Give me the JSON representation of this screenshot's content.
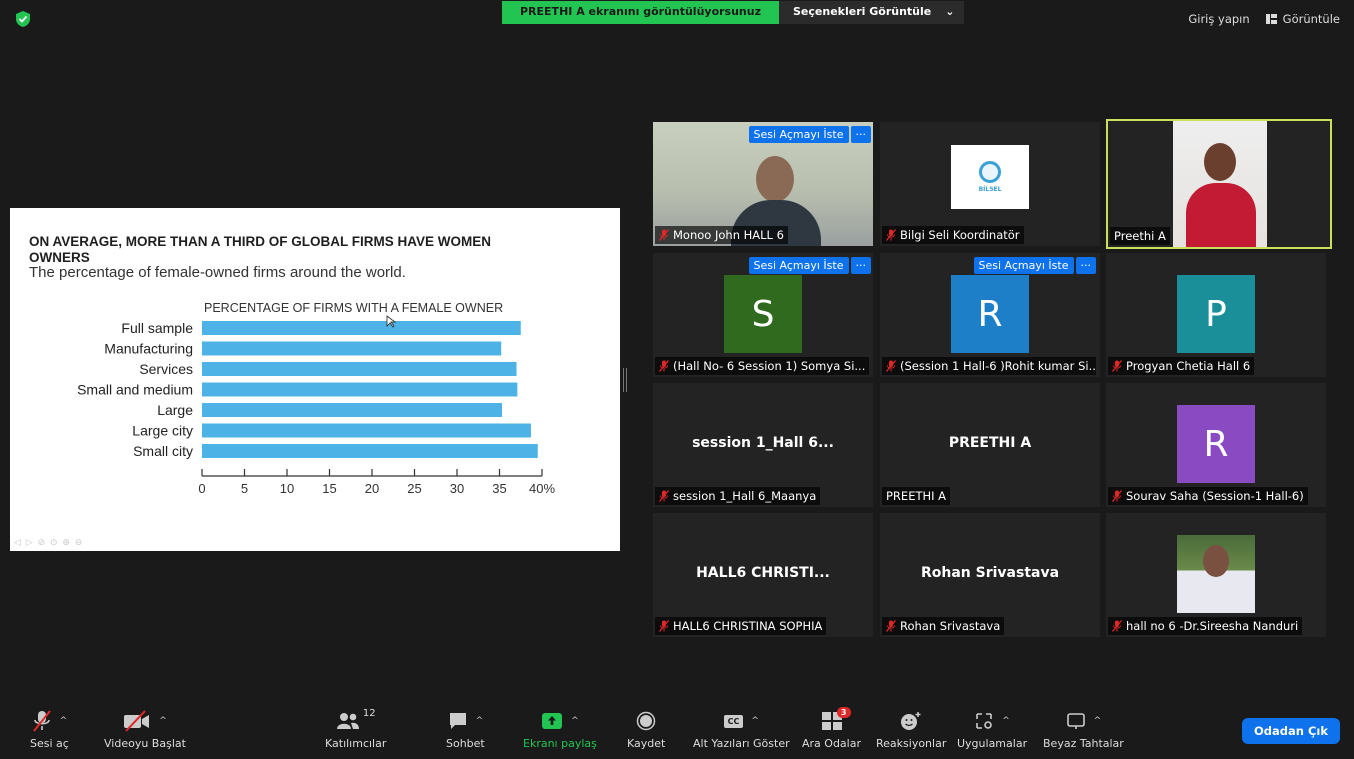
{
  "top": {
    "share_banner": "PREETHI A ekranını görüntülüyorsunuz",
    "view_options": "Seçenekleri Görüntüle",
    "sign_in": "Giriş yapın",
    "view": "Görüntüle"
  },
  "slide": {
    "title": "ON AVERAGE, MORE THAN A THIRD OF GLOBAL FIRMS HAVE WOMEN OWNERS",
    "subtitle": "The percentage of female-owned firms around the world."
  },
  "chart_data": {
    "type": "bar",
    "orientation": "horizontal",
    "title": "PERCENTAGE OF FIRMS WITH A FEMALE OWNER",
    "categories": [
      "Full sample",
      "Manufacturing",
      "Services",
      "Small and medium",
      "Large",
      "Large city",
      "Small city"
    ],
    "values": [
      37.5,
      35.2,
      37.0,
      37.1,
      35.3,
      38.7,
      39.5
    ],
    "x_ticks": [
      "0",
      "5",
      "10",
      "15",
      "20",
      "25",
      "30",
      "35",
      "40%"
    ],
    "xlim": [
      0,
      40
    ],
    "bar_color": "#4db3e6"
  },
  "participants": [
    {
      "name": "Monoo John HALL 6",
      "muted": true,
      "request": "Sesi Açmayı İste",
      "kind": "video"
    },
    {
      "name": "Bilgi Seli Koordinatör",
      "muted": true,
      "kind": "logo",
      "logo_text": "BİLSEL"
    },
    {
      "name": "Preethi A",
      "muted": false,
      "kind": "video",
      "active": true
    },
    {
      "name": "(Hall No- 6 Session 1) Somya Si...",
      "muted": true,
      "request": "Sesi Açmayı İste",
      "kind": "avatar",
      "initial": "S",
      "color": "#2f6a1f"
    },
    {
      "name": "(Session 1 Hall-6 )Rohit kumar Si...",
      "muted": true,
      "request": "Sesi Açmayı İste",
      "kind": "avatar",
      "initial": "R",
      "color": "#1e7fc9"
    },
    {
      "name": "Progyan Chetia Hall 6",
      "muted": true,
      "kind": "avatar",
      "initial": "P",
      "color": "#1a8f9a"
    },
    {
      "name": "session 1_Hall 6_Maanya",
      "muted": true,
      "kind": "text",
      "display": "session 1_Hall 6..."
    },
    {
      "name": "PREETHI A",
      "muted": false,
      "kind": "text",
      "display": "PREETHI A"
    },
    {
      "name": "Sourav Saha (Session-1 Hall-6)",
      "muted": true,
      "kind": "avatar",
      "initial": "R",
      "color": "#8a4bc2"
    },
    {
      "name": "HALL6  CHRISTINA SOPHIA",
      "muted": true,
      "kind": "text",
      "display": "HALL6  CHRISTI..."
    },
    {
      "name": "Rohan Srivastava",
      "muted": true,
      "kind": "text",
      "display": "Rohan Srivastava"
    },
    {
      "name": "hall no 6 -Dr.Sireesha Nanduri",
      "muted": true,
      "kind": "photo"
    }
  ],
  "toolbar": {
    "unmute": "Sesi aç",
    "start_video": "Videoyu Başlat",
    "participants": "Katılımcılar",
    "participants_count": "12",
    "chat": "Sohbet",
    "share_screen": "Ekranı paylaş",
    "record": "Kaydet",
    "captions": "Alt Yazıları Göster",
    "captions_badge": "CC",
    "breakout": "Ara Odalar",
    "breakout_badge": "3",
    "reactions": "Reaksiyonlar",
    "apps": "Uygulamalar",
    "whiteboards": "Beyaz Tahtalar",
    "leave": "Odadan Çık"
  },
  "colors": {
    "accent_green": "#23c552",
    "accent_blue": "#0e72ed",
    "active_border": "#c8e05a",
    "mute_red": "#e02828"
  }
}
